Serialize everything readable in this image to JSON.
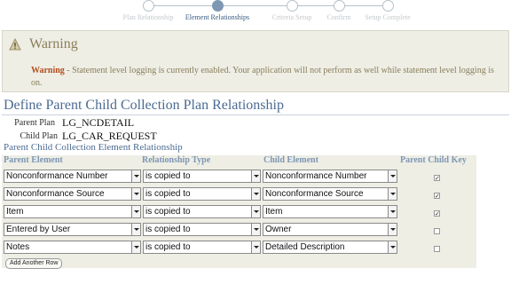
{
  "train": {
    "steps": [
      {
        "label": "Plan Relationship",
        "state": "done"
      },
      {
        "label": "Element Relationships",
        "state": "active"
      },
      {
        "label": "Criteria Setup",
        "state": "todo"
      },
      {
        "label": "Confirm",
        "state": "todo"
      },
      {
        "label": "Setup Complete",
        "state": "todo"
      }
    ]
  },
  "warning": {
    "title": "Warning",
    "lead": "Warning",
    "message": " - Statement level logging is currently enabled. Your application will not perform as well while statement level logging is on."
  },
  "page": {
    "title": "Define Parent Child Collection Plan Relationship",
    "parent_plan_label": "Parent Plan",
    "parent_plan_value": "LG_NCDETAIL",
    "child_plan_label": "Child Plan",
    "child_plan_value": "LG_CAR_REQUEST",
    "section_title": "Parent Child Collection Element Relationship"
  },
  "table": {
    "headers": {
      "parent": "Parent Element",
      "relationship": "Relationship Type",
      "child": "Child Element",
      "key": "Parent Child Key"
    },
    "rows": [
      {
        "parent": "Nonconformance Number",
        "relationship": "is copied to",
        "child": "Nonconformance Number",
        "key": true
      },
      {
        "parent": "Nonconformance Source",
        "relationship": "is copied to",
        "child": "Nonconformance Source",
        "key": true
      },
      {
        "parent": "Item",
        "relationship": "is copied to",
        "child": "Item",
        "key": true
      },
      {
        "parent": "Entered by User",
        "relationship": "is copied to",
        "child": "Owner",
        "key": false
      },
      {
        "parent": "Notes",
        "relationship": "is copied to",
        "child": "Detailed Description",
        "key": false
      }
    ],
    "add_button": "Add Another Row"
  },
  "colors": {
    "title": "#4b6b92",
    "warning_text": "#8a7e5a",
    "warning_bg": "#eeeee5",
    "header_text": "#7e97b4"
  }
}
